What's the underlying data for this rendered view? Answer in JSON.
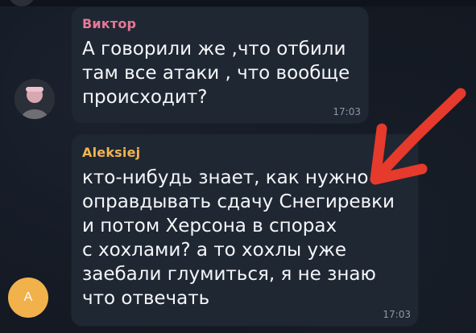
{
  "messages": [
    {
      "sender": "Виктор",
      "lines": [
        "А говорили же ,что отбили",
        "там все атаки , что вообще",
        "происходит?"
      ],
      "time": "17:03"
    },
    {
      "sender": "Aleksiej",
      "avatar_initial": "A",
      "lines": [
        "кто-нибудь знает, как нужно",
        "оправдывать сдачу Снегиревки",
        "и потом Херсона в спорах",
        "с хохлами? а то хохлы уже",
        "заебали глумиться, я не знаю",
        "что отвечать"
      ],
      "time": "17:03"
    }
  ],
  "colors": {
    "background": "#131821",
    "bubble": "#1f2733",
    "sender1": "#e67896",
    "sender2": "#f3b34e",
    "text": "#f4f6f8",
    "time": "#8d97a6",
    "avatar_a": "#f1b14b",
    "arrow": "#e53a2c"
  },
  "icons": {
    "annotation": "red-arrow-icon"
  }
}
